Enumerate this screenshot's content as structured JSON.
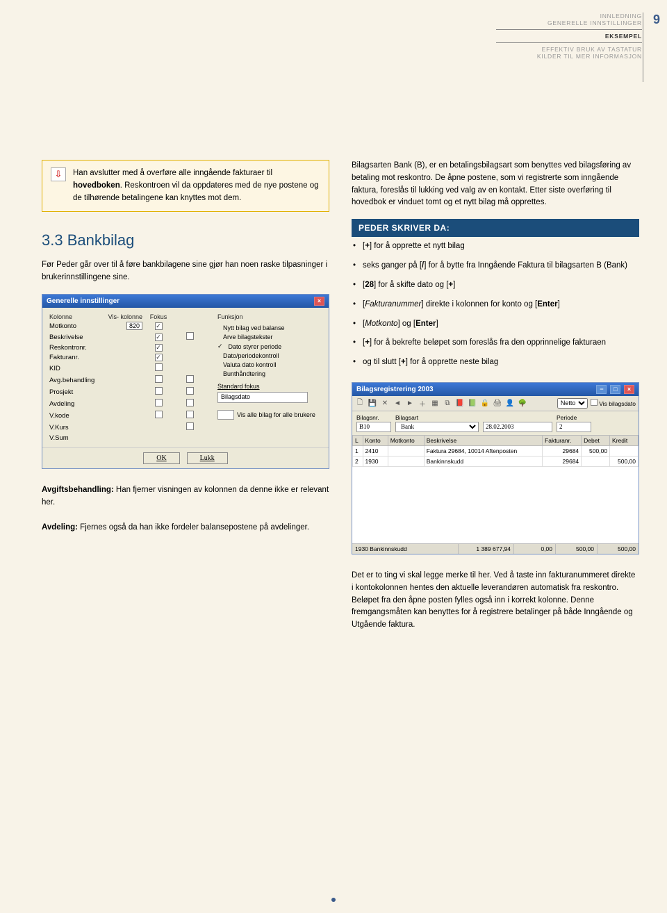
{
  "page_number": "9",
  "header_nav": {
    "items": [
      "INNLEDNING",
      "GENERELLE INNSTILLINGER",
      "EKSEMPEL",
      "EFFEKTIV BRUK AV TASTATUR",
      "KILDER TIL MER INFORMASJON"
    ],
    "active_index": 2
  },
  "callout": {
    "text_a": "Han avslutter med å overføre alle inngående fakturaer til ",
    "bold": "hovedboken",
    "text_b": ". Reskontroen vil da oppdateres med de nye postene og de tilhørende betalingene kan knyttes mot dem."
  },
  "right_intro": "Bilagsarten Bank (B), er en betalingsbilagsart som benyttes ved bilagsføring av betaling mot reskontro. De åpne postene, som vi registrerte som inngående faktura, foreslås til lukking ved valg av en kontakt. Etter siste overføring til hovedbok er vinduet tomt og et nytt bilag må opprettes.",
  "section_heading": "3.3 Bankbilag",
  "section_intro": "Før Peder går over til å føre bankbilagene sine gjør han noen raske tilpasninger i brukerinnstillingene sine.",
  "peder_title": "PEDER SKRIVER DA:",
  "peder_items": [
    {
      "pre": "[",
      "kb": "+",
      "post": "] for å opprette et nytt bilag"
    },
    {
      "pre": "seks ganger på [",
      "kb": "/",
      "post": "] for å bytte fra Inngående Faktura til bilagsarten B (Bank)"
    },
    {
      "pre": "[",
      "kb": "28",
      "post_a": "] for å skifte dato og [",
      "kb2": "+",
      "post_b": "]"
    },
    {
      "pre": "[",
      "it": "Fakturanummer",
      "post_a": "] direkte i kolonnen for konto og [",
      "kb2": "Enter",
      "post_b": "]"
    },
    {
      "pre": "[",
      "it": "Motkonto",
      "post_a": "] og [",
      "kb2": "Enter",
      "post_b": "]"
    },
    {
      "pre": "[",
      "kb": "+",
      "post": "] for å bekrefte beløpet som foreslås fra den opprinnelige fakturaen"
    },
    {
      "pre": "og til slutt [",
      "kb": "+",
      "post": "] for å opprette neste bilag"
    }
  ],
  "settings_dialog": {
    "title": "Generelle innstillinger",
    "col_headers": [
      "Kolonne",
      "Vis- kolonne",
      "Fokus",
      "Funksjon"
    ],
    "rows": [
      {
        "label": "Motkonto",
        "num": "820",
        "vis": true,
        "fokus": null
      },
      {
        "label": "Beskrivelse",
        "num": "",
        "vis": true,
        "fokus": false
      },
      {
        "label": "Reskontronr.",
        "num": "",
        "vis": true,
        "fokus": null
      },
      {
        "label": "Fakturanr.",
        "num": "",
        "vis": true,
        "fokus": null
      },
      {
        "label": "KID",
        "num": "",
        "vis": false,
        "fokus": null
      },
      {
        "label": "Avg.behandling",
        "num": "",
        "vis": false,
        "fokus": false
      },
      {
        "label": "Prosjekt",
        "num": "",
        "vis": false,
        "fokus": false
      },
      {
        "label": "Avdeling",
        "num": "",
        "vis": false,
        "fokus": false
      },
      {
        "label": "V.kode",
        "num": "",
        "vis": false,
        "fokus": false
      },
      {
        "label": "V.Kurs",
        "num": "",
        "vis": null,
        "fokus": false
      },
      {
        "label": "V.Sum",
        "num": "",
        "vis": null,
        "fokus": null
      }
    ],
    "funksjon_items": [
      {
        "checked": false,
        "label": "Nytt bilag ved balanse"
      },
      {
        "checked": false,
        "label": "Arve bilagstekster"
      },
      {
        "checked": true,
        "label": "Dato styrer periode"
      },
      {
        "checked": false,
        "label": "Dato/periodekontroll"
      },
      {
        "checked": false,
        "label": "Valuta dato kontroll"
      },
      {
        "checked": false,
        "label": "Bunthåndtering"
      }
    ],
    "std_label": "Standard fokus",
    "std_value": "Bilagsdato",
    "vis_label": "Vis alle bilag for alle brukere",
    "ok": "OK",
    "lukk": "Lukk"
  },
  "note_block": {
    "a_label": "Avgiftsbehandling:",
    "a_text": " Han fjerner visningen av kolonnen da denne ikke er relevant her.",
    "b_label": "Avdeling:",
    "b_text": " Fjernes også da han ikke fordeler balansepostene på avdelinger."
  },
  "bilag_dialog": {
    "title": "Bilagsregistrering 2003",
    "toolbar_right": "Vis bilagsdato",
    "fields": {
      "bilagsnr_label": "Bilagsnr.",
      "bilagsnr": "B10",
      "bilagsart_label": "Bilagsart",
      "bilagsart": "Bank",
      "dato": "28.02.2003",
      "periode_label": "Periode",
      "periode": "2"
    },
    "columns": [
      "L",
      "Konto",
      "Motkonto",
      "Beskrivelse",
      "Fakturanr.",
      "Debet",
      "Kredit"
    ],
    "rows": [
      {
        "L": "1",
        "Konto": "2410",
        "Motkonto": "",
        "Beskrivelse": "Faktura 29684, 10014 Aftenposten",
        "Fakturanr": "29684",
        "Debet": "500,00",
        "Kredit": ""
      },
      {
        "L": "2",
        "Konto": "1930",
        "Motkonto": "",
        "Beskrivelse": "Bankinnskudd",
        "Fakturanr": "29684",
        "Debet": "",
        "Kredit": "500,00"
      }
    ],
    "footer": {
      "konto": "1930 Bankinnskudd",
      "saldo": "1 389 677,94",
      "c1": "0,00",
      "deb": "500,00",
      "kre": "500,00"
    }
  },
  "closing_para": "Det er to ting vi skal legge merke til her. Ved å taste inn fakturanummeret direkte i kontokolonnen hentes den aktuelle leverandøren automatisk fra reskontro. Beløpet fra den åpne posten fylles også inn i korrekt kolonne. Denne fremgangsmåten kan benyttes for å registrere betalinger på både Inngående og Utgående faktura."
}
